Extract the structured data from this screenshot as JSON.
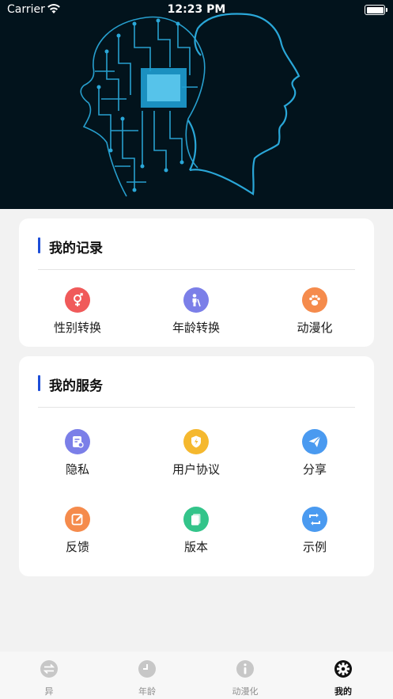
{
  "status_bar": {
    "carrier": "Carrier",
    "time": "12:23 PM"
  },
  "records": {
    "title": "我的记录",
    "items": [
      {
        "label": "性别转换",
        "icon": "gender-icon",
        "color": "#f05a5a"
      },
      {
        "label": "年龄转换",
        "icon": "age-person-icon",
        "color": "#7b7fe8"
      },
      {
        "label": "动漫化",
        "icon": "paw-icon",
        "color": "#f58b4c"
      }
    ]
  },
  "services": {
    "title": "我的服务",
    "items": [
      {
        "label": "隐私",
        "icon": "privacy-doc-icon",
        "color": "#7b7fe8"
      },
      {
        "label": "用户协议",
        "icon": "agreement-shield-icon",
        "color": "#f5b82e"
      },
      {
        "label": "分享",
        "icon": "share-plane-icon",
        "color": "#4a9af0"
      },
      {
        "label": "反馈",
        "icon": "feedback-edit-icon",
        "color": "#f58b4c"
      },
      {
        "label": "版本",
        "icon": "version-doc-icon",
        "color": "#33c48a"
      },
      {
        "label": "示例",
        "icon": "example-swap-icon",
        "color": "#4a9af0"
      }
    ]
  },
  "tabs": [
    {
      "label": "异",
      "icon": "swap-icon",
      "active": false
    },
    {
      "label": "年龄",
      "icon": "clock-icon",
      "active": false
    },
    {
      "label": "动漫化",
      "icon": "info-icon",
      "active": false
    },
    {
      "label": "我的",
      "icon": "settings-gear-icon",
      "active": true
    }
  ],
  "colors": {
    "accent": "#1d4ed8",
    "hero_bg": "#02131c",
    "circuit": "#2aa7d8"
  }
}
